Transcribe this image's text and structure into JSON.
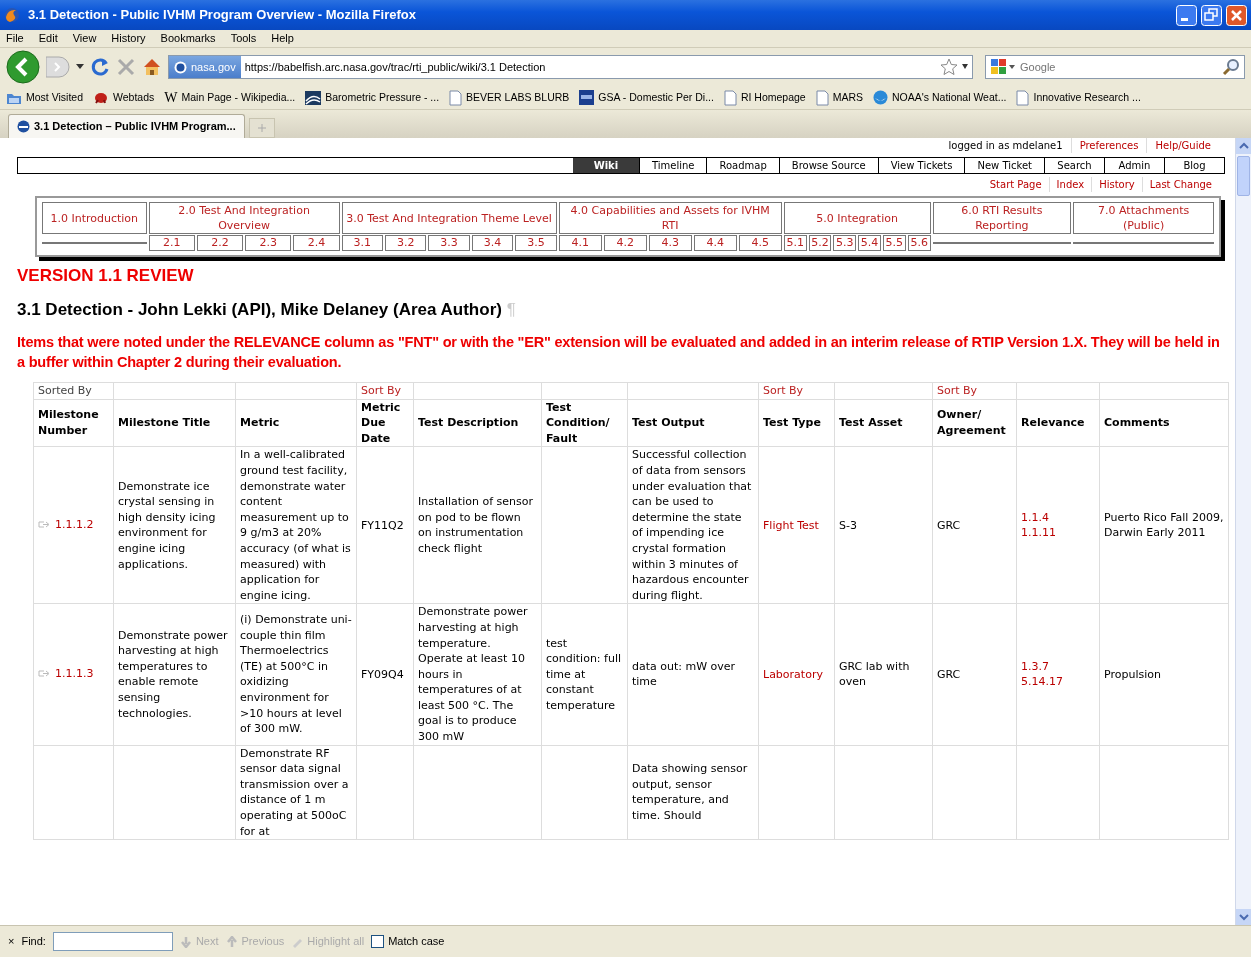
{
  "window": {
    "title": "3.1 Detection - Public IVHM Program Overview - Mozilla Firefox"
  },
  "menu": [
    "File",
    "Edit",
    "View",
    "History",
    "Bookmarks",
    "Tools",
    "Help"
  ],
  "address_bar": {
    "identity": "nasa.gov",
    "url": "https://babelfish.arc.nasa.gov/trac/rti_public/wiki/3.1 Detection"
  },
  "search": {
    "placeholder": "Google"
  },
  "bookmarks": [
    {
      "label": "Most Visited",
      "kind": "folder"
    },
    {
      "label": "Webtads",
      "kind": "creature"
    },
    {
      "label": "Main Page - Wikipedia...",
      "kind": "letter",
      "glyph": "W"
    },
    {
      "label": "Barometric Pressure - ...",
      "kind": "waves"
    },
    {
      "label": "BEVER LABS BLURB",
      "kind": "page"
    },
    {
      "label": "GSA - Domestic Per Di...",
      "kind": "square"
    },
    {
      "label": "RI Homepage",
      "kind": "page"
    },
    {
      "label": "MARS",
      "kind": "page"
    },
    {
      "label": "NOAA's National Weat...",
      "kind": "globe"
    },
    {
      "label": "Innovative Research ...",
      "kind": "page"
    }
  ],
  "tabs": [
    {
      "label": "3.1 Detection – Public IVHM Program...",
      "selected": true
    }
  ],
  "user_bar": {
    "logged_in": "logged in as mdelane1",
    "links": [
      "Preferences",
      "Help/Guide"
    ]
  },
  "main_nav": [
    {
      "label": "Wiki",
      "selected": true
    },
    {
      "label": "Timeline",
      "selected": false
    },
    {
      "label": "Roadmap",
      "selected": false
    },
    {
      "label": "Browse Source",
      "selected": false
    },
    {
      "label": "View Tickets",
      "selected": false
    },
    {
      "label": "New Ticket",
      "selected": false
    },
    {
      "label": "Search",
      "selected": false
    },
    {
      "label": "Admin",
      "selected": false
    },
    {
      "label": "Blog",
      "selected": false
    }
  ],
  "context_nav": [
    "Start Page",
    "Index",
    "History",
    "Last Change"
  ],
  "chapters": [
    {
      "title": "1.0 Introduction"
    },
    {
      "title": "2.0 Test And Integration Overview",
      "sections": [
        "2.1",
        "2.2",
        "2.3",
        "2.4"
      ]
    },
    {
      "title": "3.0 Test And Integration Theme Level",
      "sections": [
        "3.1",
        "3.2",
        "3.3",
        "3.4",
        "3.5"
      ]
    },
    {
      "title": "4.0 Capabilities and Assets for IVHM RTI",
      "sections": [
        "4.1",
        "4.2",
        "4.3",
        "4.4",
        "4.5"
      ]
    },
    {
      "title": "5.0 Integration",
      "sections": [
        "5.1",
        "5.2",
        "5.3",
        "5.4",
        "5.5",
        "5.6"
      ]
    },
    {
      "title": "6.0 RTI Results Reporting"
    },
    {
      "title": "7.0 Attachments (Public)"
    }
  ],
  "version_heading": "VERSION 1.1 REVIEW",
  "page_heading": {
    "text": "3.1 Detection - John Lekki (API), Mike Delaney (Area Author)",
    "anchor": "¶"
  },
  "notice": "Items that were noted under the RELEVANCE column as \"FNT\" or with the \"ER\" extension will be evaluated and added in an interim release of RTIP Version 1.X. They will be held in a buffer within Chapter 2 during their evaluation.",
  "table": {
    "columns": [
      {
        "label": "Milestone Number",
        "sort": {
          "text": "Sorted By",
          "link": false
        }
      },
      {
        "label": "Milestone Title"
      },
      {
        "label": "Metric"
      },
      {
        "label": "Metric Due Date",
        "sort": {
          "text": "Sort By",
          "link": true
        }
      },
      {
        "label": "Test Description"
      },
      {
        "label": "Test Condition/ Fault"
      },
      {
        "label": "Test Output"
      },
      {
        "label": "Test Type",
        "sort": {
          "text": "Sort By",
          "link": true
        }
      },
      {
        "label": "Test Asset"
      },
      {
        "label": "Owner/ Agreement",
        "sort": {
          "text": "Sort By",
          "link": true
        }
      },
      {
        "label": "Relevance"
      },
      {
        "label": "Comments"
      }
    ],
    "rows": [
      {
        "number": "1.1.1.2",
        "title": "Demonstrate ice crystal sensing in high density icing environment for engine icing applications.",
        "metric": "In a well-calibrated ground test facility, demonstrate water content measurement up to 9 g/m3 at 20% accuracy (of what is measured) with application for engine icing.",
        "due_date": "FY11Q2",
        "description": "Installation of sensor on pod to be flown on instrumentation check flight",
        "output": "Successful collection of data from sensors under evaluation that can be used to determine the state of impending ice crystal formation within 3 minutes of hazardous encounter during flight.",
        "test_type": "Flight Test",
        "asset": "S-3",
        "owner": "GRC",
        "relevance": [
          "1.1.4",
          "1.1.11"
        ],
        "comments": "Puerto Rico Fall 2009, Darwin Early 2011"
      },
      {
        "number": "1.1.1.3",
        "title": "Demonstrate power harvesting at high temperatures to enable remote sensing technologies.",
        "metric": "(i) Demonstrate uni-couple thin film Thermoelectrics (TE) at 500°C in oxidizing environment for >10 hours at level of 300 mW.",
        "due_date": "FY09Q4",
        "description": "Demonstrate power harvesting at high temperature. Operate at least 10 hours in temperatures of at least 500 °C. The goal is to produce 300 mW",
        "condition": "test condition: full time at constant temperature",
        "output": "data out: mW over time",
        "test_type": "Laboratory",
        "asset": "GRC lab with oven",
        "owner": "GRC",
        "relevance": [
          "1.3.7",
          "5.14.17"
        ],
        "comments": "Propulsion"
      },
      {
        "metric": "Demonstrate RF sensor data signal transmission over a distance of 1 m operating at 500oC for at",
        "output": "Data showing sensor output, sensor temperature, and time. Should"
      }
    ]
  },
  "find_bar": {
    "close": "×",
    "label": "Find:",
    "buttons": [
      {
        "label": "Next",
        "kind": "down",
        "disabled": true
      },
      {
        "label": "Previous",
        "kind": "up",
        "disabled": true
      },
      {
        "label": "Highlight all",
        "kind": "pen",
        "disabled": true
      }
    ],
    "match_case": {
      "label": "Match case",
      "checked": false
    }
  }
}
